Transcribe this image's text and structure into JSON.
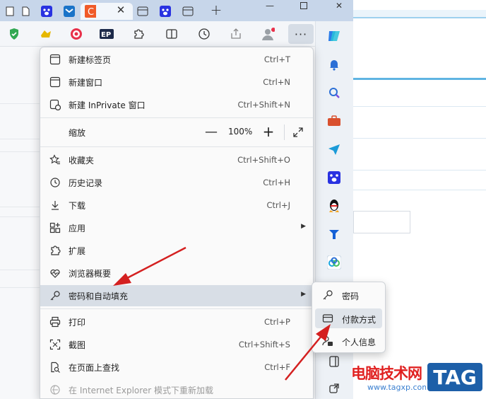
{
  "menu": {
    "new_tab": {
      "label": "新建标签页",
      "shortcut": "Ctrl+T"
    },
    "new_window": {
      "label": "新建窗口",
      "shortcut": "Ctrl+N"
    },
    "new_inprivate": {
      "label": "新建 InPrivate 窗口",
      "shortcut": "Ctrl+Shift+N"
    },
    "zoom": {
      "label": "缩放",
      "minus": "—",
      "value": "100%",
      "plus": "+"
    },
    "favorites": {
      "label": "收藏夹",
      "shortcut": "Ctrl+Shift+O"
    },
    "history": {
      "label": "历史记录",
      "shortcut": "Ctrl+H"
    },
    "downloads": {
      "label": "下载",
      "shortcut": "Ctrl+J"
    },
    "apps": {
      "label": "应用"
    },
    "extensions": {
      "label": "扩展"
    },
    "essentials": {
      "label": "浏览器概要"
    },
    "passwords": {
      "label": "密码和自动填充"
    },
    "print": {
      "label": "打印",
      "shortcut": "Ctrl+P"
    },
    "screenshot": {
      "label": "截图",
      "shortcut": "Ctrl+Shift+S"
    },
    "find": {
      "label": "在页面上查找",
      "shortcut": "Ctrl+F"
    },
    "ie_mode": {
      "label": "在 Internet Explorer 模式下重新加载"
    }
  },
  "submenu": {
    "password": "密码",
    "payment": "付款方式",
    "personal_info": "个人信息"
  },
  "toolbar": {
    "more_label": "···"
  },
  "watermark": {
    "site_name": "电脑技术网",
    "url": "www.tagxp.com",
    "badge": "TAG"
  },
  "colors": {
    "annotation_arrow": "#d42020",
    "highlight": "#d8dee6",
    "titlebar": "#c7d6ea"
  }
}
